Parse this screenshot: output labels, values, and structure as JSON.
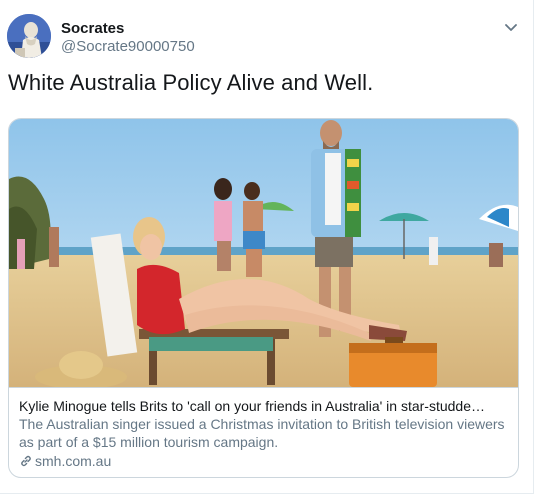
{
  "author": {
    "name": "Socrates",
    "handle": "@Socrate90000750"
  },
  "tweet": {
    "text": "White Australia Policy Alive and Well."
  },
  "card": {
    "title": "Kylie Minogue tells Brits to 'call on your friends in Australia' in star-studde…",
    "description": "The Australian singer issued a Christmas invitation to British television viewers as part of a $15 million tourism campaign.",
    "domain": "smh.com.au"
  },
  "colors": {
    "primary_text": "#14171a",
    "secondary_text": "#657786",
    "border": "#ccd6dd"
  },
  "icons": [
    "avatar-image",
    "chevron-down-icon",
    "link-icon"
  ]
}
